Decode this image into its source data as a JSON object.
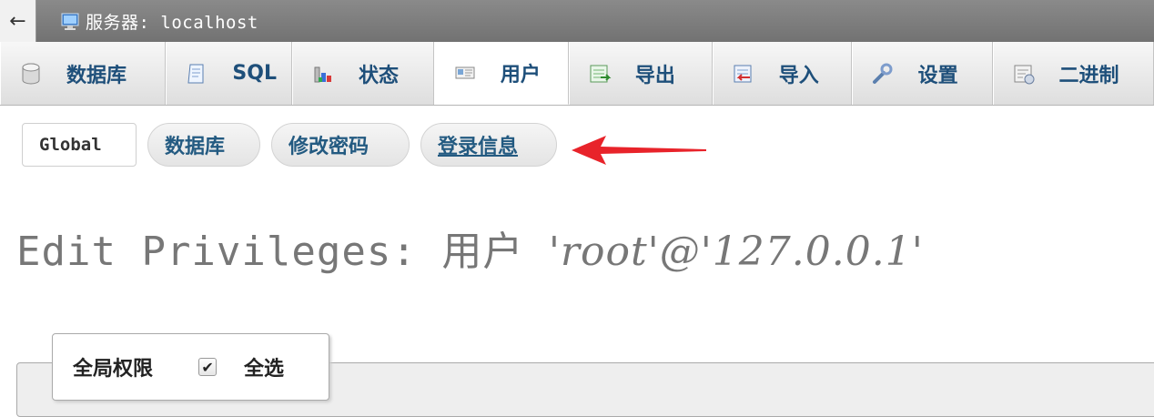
{
  "window": {
    "back_icon": "←",
    "title": "服务器: localhost"
  },
  "tabs": [
    {
      "label": "数据库",
      "icon": "database-icon"
    },
    {
      "label": "SQL",
      "icon": "sql-icon"
    },
    {
      "label": "状态",
      "icon": "status-chart-icon"
    },
    {
      "label": "用户",
      "icon": "users-icon",
      "active": true
    },
    {
      "label": "导出",
      "icon": "export-icon"
    },
    {
      "label": "导入",
      "icon": "import-icon"
    },
    {
      "label": "设置",
      "icon": "wrench-icon"
    },
    {
      "label": "二进制",
      "icon": "binlog-icon"
    }
  ],
  "subtabs": [
    {
      "label": "Global"
    },
    {
      "label": "数据库"
    },
    {
      "label": "修改密码"
    },
    {
      "label": "登录信息"
    }
  ],
  "heading": {
    "prefix": "Edit Privileges: 用户 ",
    "user": "'root'@'127.0.0.1'"
  },
  "fieldset": {
    "legend": "全局权限",
    "check_all_label": "全选",
    "check_all_checked": true,
    "check_mark": "✔"
  },
  "colors": {
    "titlebar": "#7a7a7a",
    "link_blue": "#235a81",
    "annotation_arrow": "#e8232a"
  }
}
